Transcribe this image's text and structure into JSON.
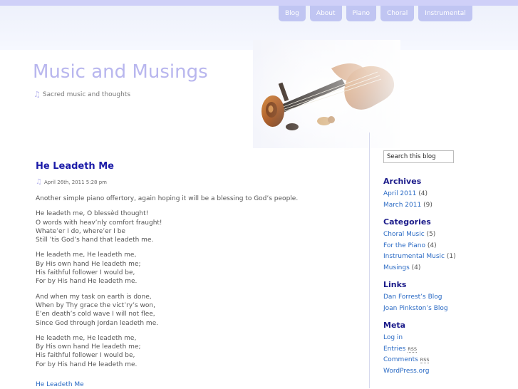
{
  "nav": [
    "Blog",
    "About",
    "Piano",
    "Choral",
    "Instrumental"
  ],
  "site": {
    "title": "Music and Musings",
    "tagline": "Sacred music and thoughts",
    "header_image": "violin-scroll-image"
  },
  "post": {
    "title": "He Leadeth Me",
    "date": "April 26th, 2011 5:28 pm",
    "intro": "Another simple piano offertory, again hoping it will be a blessing to God’s people.",
    "verses": [
      "He leadeth me, O blessèd thought!\nO words with heav’nly comfort fraught!\nWhate’er I do, where’er I be\nStill ’tis God’s hand that leadeth me.",
      "He leadeth me, He leadeth me,\nBy His own hand He leadeth me;\nHis faithful follower I would be,\nFor by His hand He leadeth me.",
      "And when my task on earth is done,\nWhen by Thy grace the vict’ry’s won,\nE’en death’s cold wave I will not flee,\nSince God through Jordan leadeth me.",
      "He leadeth me, He leadeth me,\nBy His own hand He leadeth me;\nHis faithful follower I would be,\nFor by His hand He leadeth me."
    ],
    "link": "He Leadeth Me"
  },
  "sidebar": {
    "search_value": "Search this blog",
    "archives": {
      "title": "Archives",
      "items": [
        {
          "label": "April 2011",
          "count": "(4)"
        },
        {
          "label": "March 2011",
          "count": "(9)"
        }
      ]
    },
    "categories": {
      "title": "Categories",
      "items": [
        {
          "label": "Choral Music",
          "count": "(5)"
        },
        {
          "label": "For the Piano",
          "count": "(4)"
        },
        {
          "label": "Instrumental Music",
          "count": "(1)"
        },
        {
          "label": "Musings",
          "count": "(4)"
        }
      ]
    },
    "links": {
      "title": "Links",
      "items": [
        {
          "label": "Dan Forrest’s Blog"
        },
        {
          "label": "Joan Pinkston’s Blog"
        }
      ]
    },
    "meta": {
      "title": "Meta",
      "items": [
        {
          "label": "Log in"
        },
        {
          "label": "Entries",
          "rss": "RSS"
        },
        {
          "label": "Comments",
          "rss": "RSS"
        },
        {
          "label": "WordPress.org"
        }
      ]
    }
  },
  "colors": {
    "nav_tab": "#c0c5f2",
    "site_title": "#b8b6ee",
    "heading": "#1b1ba8",
    "link": "#2a6ac4"
  }
}
